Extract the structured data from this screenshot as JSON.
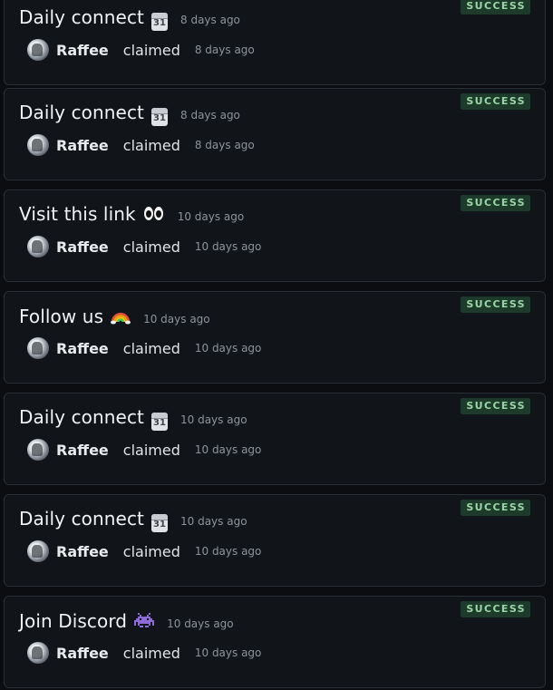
{
  "status_colors": {
    "success_bg": "#1d3a2a",
    "success_text": "#9ad7a8"
  },
  "activity_feed": [
    {
      "quest_title": "Daily connect",
      "quest_icon": "calendar-icon",
      "quest_icon_text": "31",
      "quest_time": "8 days ago",
      "status": "SUCCESS",
      "claimer": "Raffee",
      "action": "claimed",
      "claim_time": "8 days ago"
    },
    {
      "quest_title": "Daily connect",
      "quest_icon": "calendar-icon",
      "quest_icon_text": "31",
      "quest_time": "8 days ago",
      "status": "SUCCESS",
      "claimer": "Raffee",
      "action": "claimed",
      "claim_time": "8 days ago"
    },
    {
      "quest_title": "Visit this link",
      "quest_icon": "eyes-icon",
      "quest_time": "10 days ago",
      "status": "SUCCESS",
      "claimer": "Raffee",
      "action": "claimed",
      "claim_time": "10 days ago"
    },
    {
      "quest_title": "Follow us",
      "quest_icon": "rainbow-icon",
      "quest_time": "10 days ago",
      "status": "SUCCESS",
      "claimer": "Raffee",
      "action": "claimed",
      "claim_time": "10 days ago"
    },
    {
      "quest_title": "Daily connect",
      "quest_icon": "calendar-icon",
      "quest_icon_text": "31",
      "quest_time": "10 days ago",
      "status": "SUCCESS",
      "claimer": "Raffee",
      "action": "claimed",
      "claim_time": "10 days ago"
    },
    {
      "quest_title": "Daily connect",
      "quest_icon": "calendar-icon",
      "quest_icon_text": "31",
      "quest_time": "10 days ago",
      "status": "SUCCESS",
      "claimer": "Raffee",
      "action": "claimed",
      "claim_time": "10 days ago"
    },
    {
      "quest_title": "Join Discord",
      "quest_icon": "alien-monster-icon",
      "quest_time": "10 days ago",
      "status": "SUCCESS",
      "claimer": "Raffee",
      "action": "claimed",
      "claim_time": "10 days ago"
    }
  ]
}
